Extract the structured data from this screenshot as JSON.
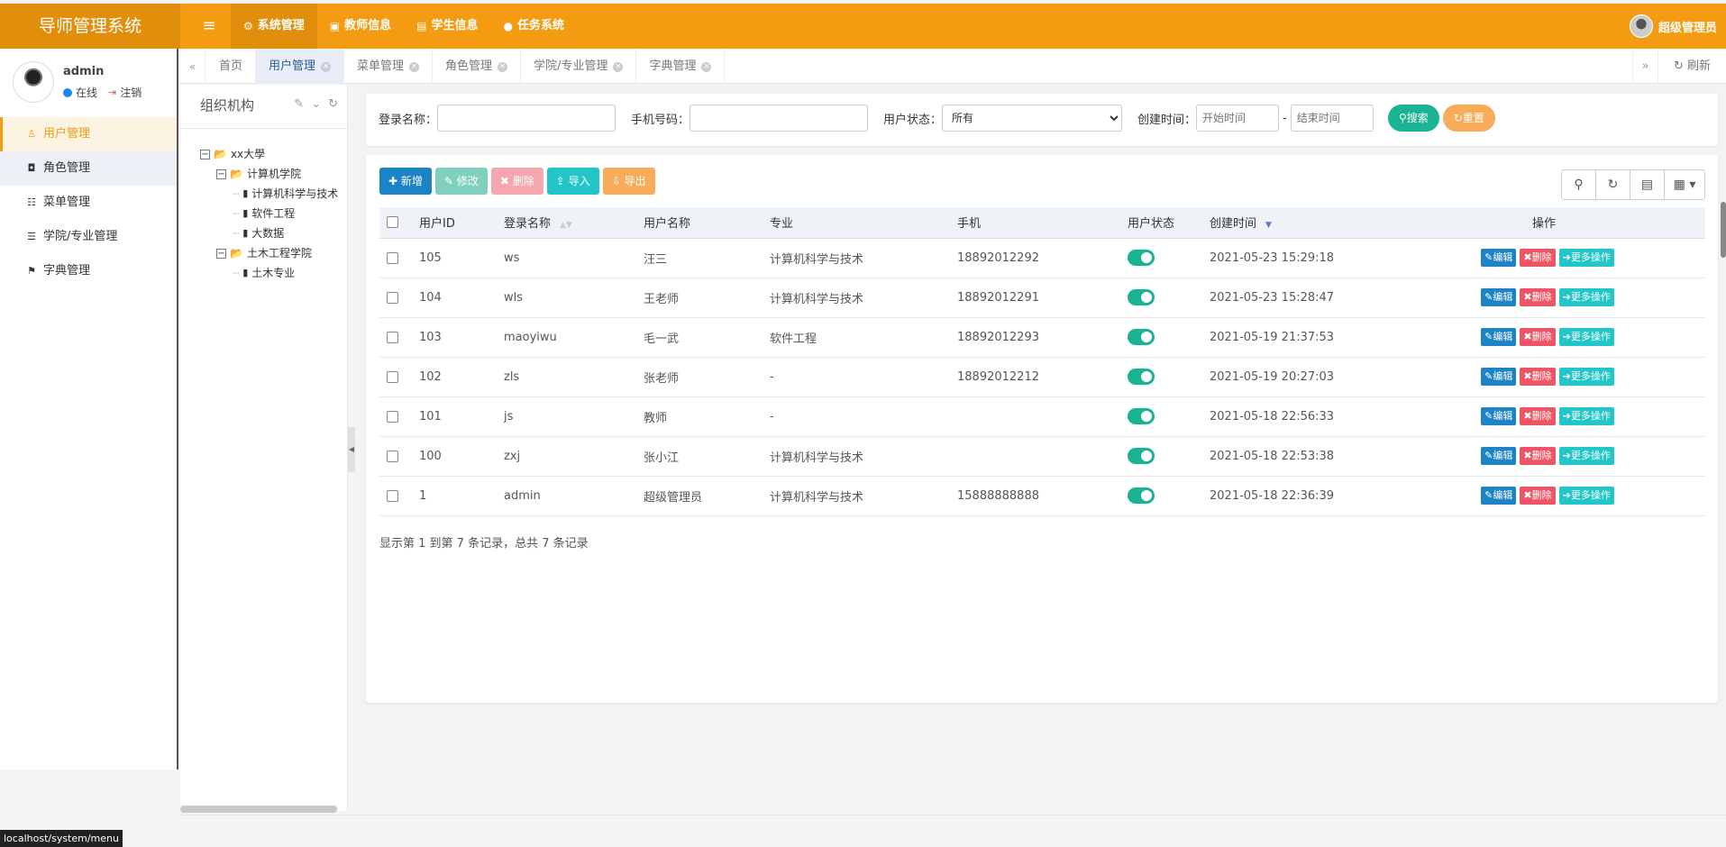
{
  "app": {
    "title": "导师管理系统"
  },
  "topnav": [
    {
      "label": "系统管理",
      "icon": "gear-icon",
      "glyph": "⚙"
    },
    {
      "label": "教师信息",
      "icon": "id-card-icon",
      "glyph": "▣"
    },
    {
      "label": "学生信息",
      "icon": "address-card-icon",
      "glyph": "▤"
    },
    {
      "label": "任务系统",
      "icon": "tint-icon",
      "glyph": "●"
    }
  ],
  "top_user": {
    "name": "超级管理员"
  },
  "sidebar": {
    "username": "admin",
    "status": "在线",
    "logout": "注销",
    "items": [
      {
        "label": "用户管理",
        "icon": "user-icon",
        "glyph": "♙"
      },
      {
        "label": "角色管理",
        "icon": "lock-icon",
        "glyph": "🔒"
      },
      {
        "label": "菜单管理",
        "icon": "th-list-icon",
        "glyph": "☷"
      },
      {
        "label": "学院/专业管理",
        "icon": "list-icon",
        "glyph": "☰"
      },
      {
        "label": "字典管理",
        "icon": "bookmark-icon",
        "glyph": "⚑"
      }
    ]
  },
  "tabs": [
    {
      "label": "首页",
      "closable": false
    },
    {
      "label": "用户管理",
      "closable": true
    },
    {
      "label": "菜单管理",
      "closable": true
    },
    {
      "label": "角色管理",
      "closable": true
    },
    {
      "label": "学院/专业管理",
      "closable": true
    },
    {
      "label": "字典管理",
      "closable": true
    }
  ],
  "tab_refresh": "刷新",
  "org": {
    "title": "组织机构",
    "tree": {
      "root": "xx大學",
      "college1": "计算机学院",
      "c1_items": [
        "计算机科学与技术",
        "软件工程",
        "大数据"
      ],
      "college2": "土木工程学院",
      "c2_items": [
        "土木专业"
      ]
    }
  },
  "search": {
    "login_label": "登录名称：",
    "login_value": "",
    "phone_label": "手机号码：",
    "phone_value": "",
    "status_label": "用户状态：",
    "status_value": "所有",
    "time_label": "创建时间：",
    "start_placeholder": "开始时间",
    "sep": "-",
    "end_placeholder": "结束时间",
    "search_btn": "搜索",
    "reset_btn": "重置"
  },
  "toolbar": {
    "add": "新增",
    "edit": "修改",
    "delete": "删除",
    "import": "导入",
    "export": "导出"
  },
  "table": {
    "headers": [
      "用户ID",
      "登录名称",
      "用户名称",
      "专业",
      "手机",
      "用户状态",
      "创建时间",
      "操作"
    ],
    "rows": [
      {
        "id": "105",
        "login": "ws",
        "name": "汪三",
        "major": "计算机科学与技术",
        "phone": "18892012292",
        "time": "2021-05-23 15:29:18"
      },
      {
        "id": "104",
        "login": "wls",
        "name": "王老师",
        "major": "计算机科学与技术",
        "phone": "18892012291",
        "time": "2021-05-23 15:28:47"
      },
      {
        "id": "103",
        "login": "maoyiwu",
        "name": "毛一武",
        "major": "软件工程",
        "phone": "18892012293",
        "time": "2021-05-19 21:37:53"
      },
      {
        "id": "102",
        "login": "zls",
        "name": "张老师",
        "major": "-",
        "phone": "18892012212",
        "time": "2021-05-19 20:27:03"
      },
      {
        "id": "101",
        "login": "js",
        "name": "教师",
        "major": "-",
        "phone": "",
        "time": "2021-05-18 22:56:33"
      },
      {
        "id": "100",
        "login": "zxj",
        "name": "张小江",
        "major": "计算机科学与技术",
        "phone": "",
        "time": "2021-05-18 22:53:38"
      },
      {
        "id": "1",
        "login": "admin",
        "name": "超级管理员",
        "major": "计算机科学与技术",
        "phone": "15888888888",
        "time": "2021-05-18 22:36:39"
      }
    ],
    "op_edit": "编辑",
    "op_delete": "删除",
    "op_more": "更多操作",
    "footer": "显示第 1 到第 7 条记录，总共 7 条记录"
  },
  "statusbar": "localhost/system/menu",
  "colors": {
    "accent": "#f39c12",
    "accent_dark": "#e08e0b",
    "primary": "#1c84c6",
    "danger": "#ed5565",
    "info": "#23c6c8",
    "success": "#1ab394",
    "warning": "#f8ac59"
  }
}
